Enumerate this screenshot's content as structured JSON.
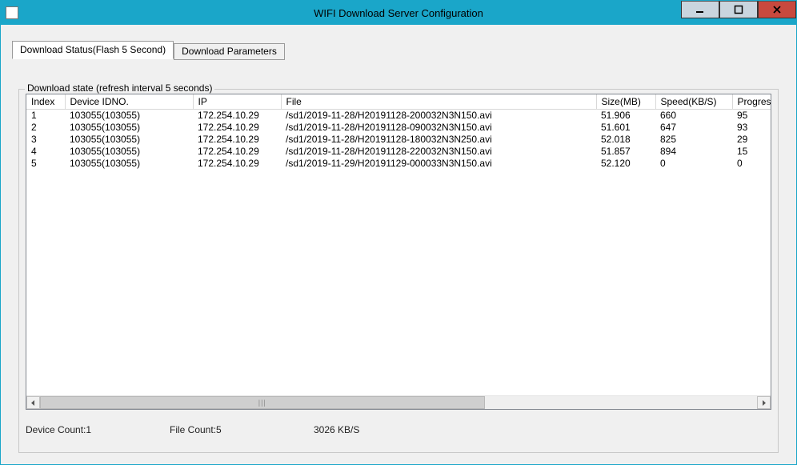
{
  "window": {
    "title": "WIFI Download Server Configuration"
  },
  "tabs": {
    "active": "Download Status(Flash 5 Second)",
    "inactive": "Download Parameters"
  },
  "group": {
    "legend": "Download state (refresh interval 5 seconds)"
  },
  "columns": {
    "index": "Index",
    "device": "Device IDNO.",
    "ip": "IP",
    "file": "File",
    "size": "Size(MB)",
    "speed": "Speed(KB/S)",
    "progress": "Progress(%)"
  },
  "rows": [
    {
      "index": "1",
      "device": "103055(103055)",
      "ip": "172.254.10.29",
      "file": "/sd1/2019-11-28/H20191128-200032N3N150.avi",
      "size": "51.906",
      "speed": "660",
      "progress": "95"
    },
    {
      "index": "2",
      "device": "103055(103055)",
      "ip": "172.254.10.29",
      "file": "/sd1/2019-11-28/H20191128-090032N3N150.avi",
      "size": "51.601",
      "speed": "647",
      "progress": "93"
    },
    {
      "index": "3",
      "device": "103055(103055)",
      "ip": "172.254.10.29",
      "file": "/sd1/2019-11-28/H20191128-180032N3N250.avi",
      "size": "52.018",
      "speed": "825",
      "progress": "29"
    },
    {
      "index": "4",
      "device": "103055(103055)",
      "ip": "172.254.10.29",
      "file": "/sd1/2019-11-28/H20191128-220032N3N150.avi",
      "size": "51.857",
      "speed": "894",
      "progress": "15"
    },
    {
      "index": "5",
      "device": "103055(103055)",
      "ip": "172.254.10.29",
      "file": "/sd1/2019-11-29/H20191129-000033N3N150.avi",
      "size": "52.120",
      "speed": "0",
      "progress": "0"
    }
  ],
  "status": {
    "device_count": "Device Count:1",
    "file_count": "File Count:5",
    "throughput": "3026 KB/S"
  }
}
